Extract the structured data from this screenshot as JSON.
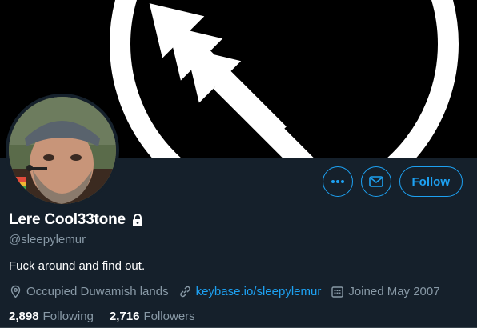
{
  "profile": {
    "display_name": "Lere Cool33tone",
    "handle": "@sleepylemur",
    "bio": "Fuck around and find out.",
    "protected_icon": "lock-icon",
    "location": "Occupied Duwamish lands",
    "website": "keybase.io/sleepylemur",
    "joined": "Joined May 2007"
  },
  "actions": {
    "more_icon": "more-icon",
    "message_icon": "mail-icon",
    "follow_label": "Follow"
  },
  "stats": {
    "following_count": "2,898",
    "following_label": "Following",
    "followers_count": "2,716",
    "followers_label": "Followers"
  },
  "colors": {
    "background": "#15202b",
    "accent": "#1da1f2",
    "muted": "#8899a6",
    "banner": "#000000"
  }
}
